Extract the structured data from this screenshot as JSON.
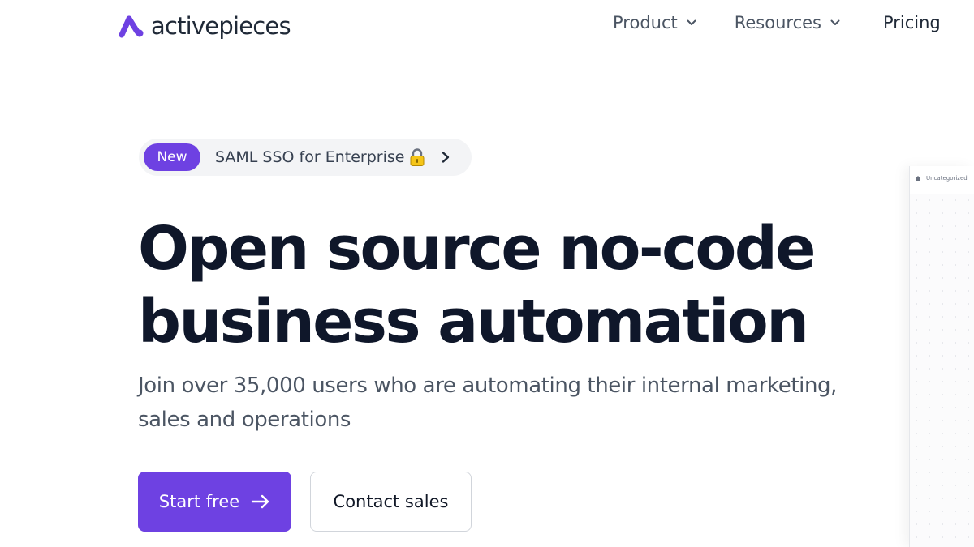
{
  "brand": {
    "name": "activepieces",
    "accent": "#6e41e2"
  },
  "nav": {
    "items": [
      {
        "label": "Product",
        "has_dropdown": true
      },
      {
        "label": "Resources",
        "has_dropdown": true
      },
      {
        "label": "Pricing",
        "has_dropdown": false
      }
    ]
  },
  "announcement": {
    "badge": "New",
    "text": "SAML SSO for Enterprise",
    "icon": "lock-icon",
    "arrow_icon": "chevron-right-icon"
  },
  "hero": {
    "title_lines": [
      "Open source no-code",
      "business automation"
    ],
    "subtitle_lines": [
      "Join over 35,000 users who are automating their internal marketing,",
      "sales and operations"
    ]
  },
  "cta": {
    "primary_label": "Start free",
    "primary_icon": "arrow-right-icon",
    "secondary_label": "Contact sales"
  },
  "preview": {
    "breadcrumb": "Uncategorized"
  }
}
